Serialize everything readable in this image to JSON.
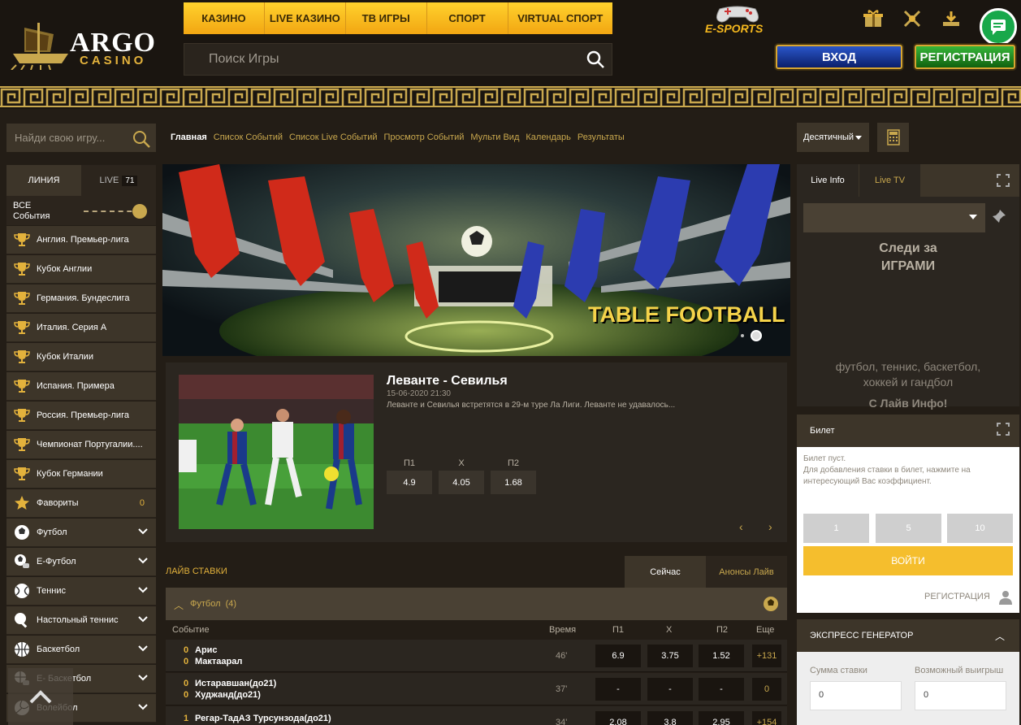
{
  "header": {
    "logo_top": "ARGO",
    "logo_bottom": "CASINO",
    "nav": [
      "КАЗИНО",
      "LIVE КАЗИНО",
      "ТВ ИГРЫ",
      "СПОРТ",
      "VIRTUAL СПОРТ"
    ],
    "search_placeholder": "Поиск Игры",
    "esports": "E-SPORTS",
    "login": "ВХОД",
    "register": "РЕГИСТРАЦИЯ"
  },
  "sidebar": {
    "search_placeholder": "Найди свою игру...",
    "tab_line": "ЛИНИЯ",
    "tab_live": "LIVE",
    "live_count": "71",
    "all_events": "ВСЕ События",
    "items": [
      {
        "label": "Англия. Премьер-лига",
        "icon": "trophy"
      },
      {
        "label": "Кубок Англии",
        "icon": "trophy"
      },
      {
        "label": "Германия. Бундеслига",
        "icon": "trophy"
      },
      {
        "label": "Италия. Серия А",
        "icon": "trophy"
      },
      {
        "label": "Кубок Италии",
        "icon": "trophy"
      },
      {
        "label": "Испания. Примера",
        "icon": "trophy"
      },
      {
        "label": "Россия. Премьер-лига",
        "icon": "trophy"
      },
      {
        "label": "Чемпионат Португалии....",
        "icon": "trophy"
      },
      {
        "label": "Кубок Германии",
        "icon": "trophy"
      },
      {
        "label": "Фавориты",
        "icon": "star",
        "count": "0"
      },
      {
        "label": "Футбол",
        "icon": "soccer"
      },
      {
        "label": "E-Футбол",
        "icon": "esoccer"
      },
      {
        "label": "Теннис",
        "icon": "tennis"
      },
      {
        "label": "Настольный теннис",
        "icon": "pingpong"
      },
      {
        "label": "Баскетбол",
        "icon": "basketball"
      },
      {
        "label": "E- Баскетбол",
        "icon": "ebasketball"
      },
      {
        "label": "Волейбол",
        "icon": "volleyball"
      }
    ]
  },
  "subnav": [
    "Главная",
    "Список Событий",
    "Список Live Событий",
    "Просмотр Событий",
    "Мульти Вид",
    "Календарь",
    "Результаты"
  ],
  "banner": {
    "text": "TABLE FOOTBALL"
  },
  "featured": {
    "title": "Леванте - Севилья",
    "date": "15-06-2020 21:30",
    "desc": "Леванте и Севилья встретятся в 29-м туре Ла Лиги. Леванте не удавалось...",
    "odds": [
      {
        "label": "П1",
        "value": "4.9"
      },
      {
        "label": "Х",
        "value": "4.05"
      },
      {
        "label": "П2",
        "value": "1.68"
      }
    ]
  },
  "live": {
    "title": "ЛАЙВ СТАВКИ",
    "tab_now": "Сейчас",
    "tab_announce": "Анонсы Лайв",
    "sport": "Футбол",
    "sport_count": "(4)",
    "cols": {
      "event": "Событие",
      "time": "Время",
      "p1": "П1",
      "x": "Х",
      "p2": "П2",
      "more": "Еще"
    },
    "events": [
      {
        "s1": "0",
        "t1": "Арис",
        "s2": "0",
        "t2": "Мактаарал",
        "time": "46'",
        "p1": "6.9",
        "x": "3.75",
        "p2": "1.52",
        "more": "+131"
      },
      {
        "s1": "0",
        "t1": "Истаравшан(до21)",
        "s2": "0",
        "t2": "Худжанд(до21)",
        "time": "37'",
        "p1": "-",
        "x": "-",
        "p2": "-",
        "more": "0"
      },
      {
        "s1": "1",
        "t1": "Регар-ТадАЗ Турсунзода(до21)",
        "s2": "",
        "t2": "",
        "time": "34'",
        "p1": "2.08",
        "x": "3.8",
        "p2": "2.95",
        "more": "+154"
      }
    ]
  },
  "right": {
    "odds_format": "Десятичный",
    "liveinfo_tab": "Live Info",
    "livetv_tab": "Live TV",
    "follow_title": "Следи за ИГРАМИ",
    "follow_text": "футбол, теннис, баскетбол, хоккей и гандбол",
    "follow_bold": "С Лайв Инфо!",
    "ticket_title": "Билет",
    "ticket_empty": "Билет пуст.",
    "ticket_hint": "Для добавления ставки в билет, нажмите на интересующий Вас коэффициент.",
    "quick": [
      "1",
      "5",
      "10"
    ],
    "login_btn": "ВОЙТИ",
    "register_link": "РЕГИСТРАЦИЯ",
    "express_title": "ЭКСПРЕСС ГЕНЕРАТОР",
    "stake_label": "Сумма ставки",
    "win_label": "Возможный выигрыш",
    "stake_value": "0",
    "win_value": "0"
  }
}
